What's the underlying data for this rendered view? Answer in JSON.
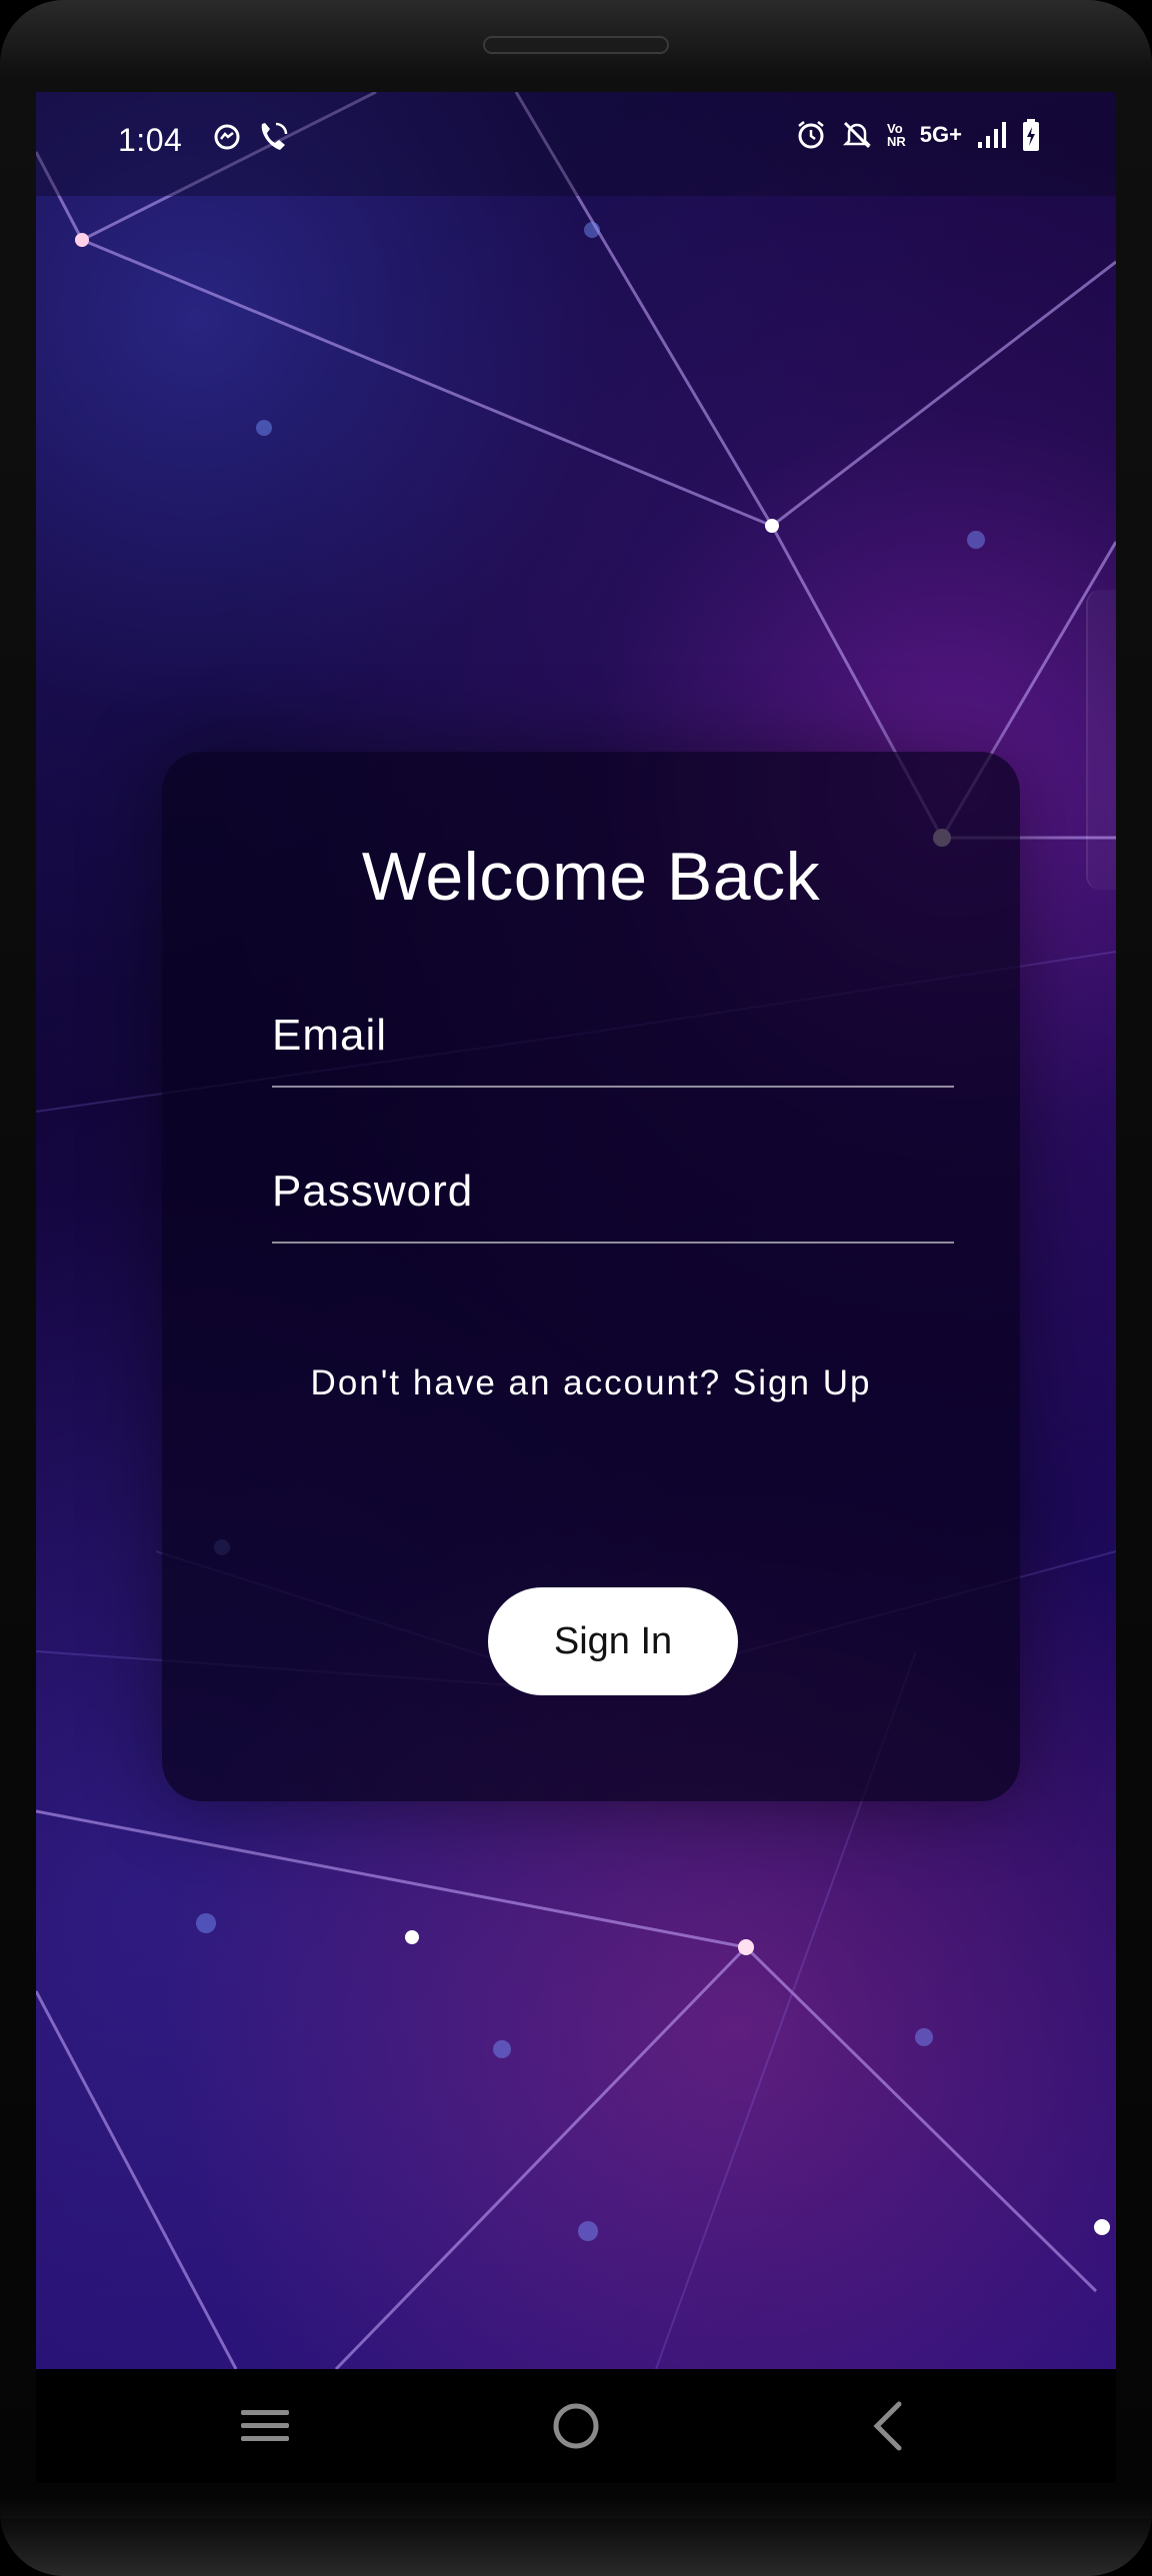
{
  "status_bar": {
    "time": "1:04",
    "left_icons": [
      "messenger-icon",
      "wifi-call-icon"
    ],
    "right_icons": [
      "alarm-icon",
      "mute-icon",
      "volte-icon",
      "5g-icon",
      "signal-icon",
      "battery-charging-icon"
    ],
    "volte_top": "Vo",
    "volte_bottom": "NR",
    "network": "5G+"
  },
  "login": {
    "title": "Welcome Back",
    "email_placeholder": "Email",
    "password_placeholder": "Password",
    "signup_text": "Don't have an account? Sign Up",
    "signin_label": "Sign In"
  },
  "nav_bar": {
    "buttons": [
      "menu-icon",
      "home-icon",
      "back-icon"
    ]
  },
  "colors": {
    "background_dark": "#12063a",
    "background_accent": "#2a107a",
    "glow_pink": "#e0409a",
    "card": "#08021e",
    "button_bg": "#ffffff",
    "text": "#ffffff"
  }
}
